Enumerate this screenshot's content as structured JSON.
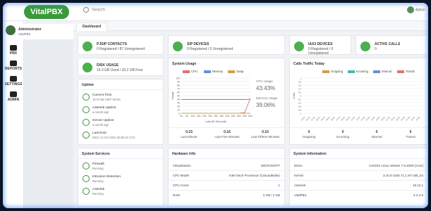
{
  "app": {
    "logo": "VitalPBX",
    "search_placeholder": "Search",
    "user_top": "Admin"
  },
  "user": {
    "name": "Administrator",
    "role": "VitalPBX"
  },
  "nav": [
    {
      "label": "PBX"
    },
    {
      "label": "REPORTS"
    },
    {
      "label": "SETTINGS"
    },
    {
      "label": "ADMIN"
    }
  ],
  "tab": {
    "label": "Dashboard"
  },
  "stats": [
    {
      "title": "PJSIP CONTACTS",
      "value": "0 Registered / 87 Unregistered"
    },
    {
      "title": "SIP DEVICES",
      "value": "0 Registered / 0 Unregistered"
    },
    {
      "title": "IAX2 DEVICES",
      "value": "0 Registered / 0 Unregistered"
    },
    {
      "title": "ACTIVE CALLS",
      "value": "0"
    }
  ],
  "disk": {
    "title": "DISK USAGE",
    "value": "16.3 GB Used / 33.2 GB Free"
  },
  "uptime": {
    "title": "Uptime",
    "rows": [
      {
        "title": "Current Time",
        "sub": "15:47:56 GMT+00:00"
      },
      {
        "title": "Asterisk Uptime",
        "sub": "a month ago"
      },
      {
        "title": "Server Uptime",
        "sub": "a month ago"
      },
      {
        "title": "Last boot",
        "sub": "Wed, 12 Oct 2022 20:55:31 UTC"
      }
    ]
  },
  "services": {
    "title": "System Services",
    "rows": [
      {
        "title": "Firewall",
        "sub": "Running"
      },
      {
        "title": "Intrusion Detection",
        "sub": "Running"
      },
      {
        "title": "Asterisk",
        "sub": "Running"
      }
    ]
  },
  "sys_usage": {
    "title": "System Usage",
    "legend": [
      "CPU",
      "Memory",
      "Swap"
    ],
    "cpu_label": "CPU Usage",
    "cpu_value": "43.43%",
    "mem_label": "Memory Usage",
    "mem_value": "39.06%",
    "ylabel": "Usage",
    "xlabel": "Last 60 Seconds",
    "footer": [
      {
        "value": "0.15",
        "label": "Last Minute"
      },
      {
        "value": "0.16",
        "label": "Last Five Minutes"
      },
      {
        "value": "0.15",
        "label": "Last Fifteen Minutes"
      }
    ]
  },
  "calls": {
    "title": "Calls Traffic Today",
    "legend": [
      "Outgoing",
      "Incoming",
      "Internal",
      "Transit"
    ],
    "ylabel": "Calls",
    "footer": [
      {
        "value": "0",
        "label": "Outgoing"
      },
      {
        "value": "0",
        "label": "Incoming"
      },
      {
        "value": "0",
        "label": "Internal"
      },
      {
        "value": "0",
        "label": "Transit"
      }
    ]
  },
  "hardware": {
    "title": "Hardware Info",
    "rows": [
      {
        "k": "Virtualization",
        "v": "MICROSOFT"
      },
      {
        "k": "CPU Model",
        "v": "Intel Xeon Processor (Cascadelake)"
      },
      {
        "k": "CPU Cores",
        "v": "1"
      },
      {
        "k": "RAM",
        "v": "2 GB / 2 GB"
      }
    ]
  },
  "sysinfo": {
    "title": "System Information",
    "rows": [
      {
        "k": "Distro",
        "v": "CentOS Linux release 7.9.2009 (Core)"
      },
      {
        "k": "Kernel",
        "v": "3.10.0-1160.71.1.el7.x86_64"
      },
      {
        "k": "Asterisk",
        "v": "18.12.1"
      },
      {
        "k": "VitalPBX",
        "v": "3.2.3-5"
      }
    ]
  },
  "colors": {
    "cpu": "#e0736b",
    "memory": "#6b8fd6",
    "swap": "#c9a24a",
    "outgoing": "#c9a24a",
    "incoming": "#4db6ac",
    "internal": "#6b8fd6",
    "transit": "#e0736b",
    "green": "#4caf50"
  },
  "chart_data": [
    {
      "type": "line",
      "x": [
        "0s",
        "5s",
        "10s",
        "15s",
        "20s",
        "25s",
        "30s",
        "35s",
        "40s",
        "45s",
        "50s",
        "55s",
        "60s"
      ],
      "series": [
        {
          "name": "CPU",
          "values": [
            0,
            0,
            0,
            0,
            0,
            0,
            0,
            0,
            0,
            0,
            0,
            2,
            43
          ]
        },
        {
          "name": "Memory",
          "values": [
            39,
            39,
            39,
            39,
            39,
            39,
            39,
            39,
            39,
            39,
            39,
            39,
            39
          ]
        },
        {
          "name": "Swap",
          "values": [
            0,
            0,
            0,
            0,
            0,
            0,
            0,
            0,
            0,
            0,
            0,
            0,
            0
          ]
        }
      ],
      "ylabel": "Usage",
      "xlabel": "Last 60 Seconds",
      "ylim": [
        0,
        100
      ]
    },
    {
      "type": "bar",
      "categories": [
        "00:00",
        "01:00",
        "02:00",
        "03:00",
        "04:00",
        "05:00",
        "06:00",
        "07:00",
        "08:00",
        "09:00",
        "10:00",
        "11:00",
        "12:00",
        "13:00",
        "14:00",
        "15:00",
        "16:00",
        "17:00",
        "18:00",
        "19:00",
        "20:00",
        "21:00",
        "22:00",
        "23:00"
      ],
      "series": [
        {
          "name": "Outgoing",
          "values": [
            0,
            0,
            0,
            0,
            0,
            0,
            0,
            0,
            0,
            0,
            0,
            0,
            0,
            0,
            0,
            0,
            0,
            0,
            0,
            0,
            0,
            0,
            0,
            0
          ]
        },
        {
          "name": "Incoming",
          "values": [
            0,
            0,
            0,
            0,
            0,
            0,
            0,
            0,
            0,
            0,
            0,
            0,
            0,
            0,
            0,
            0,
            0,
            0,
            0,
            0,
            0,
            0,
            0,
            0
          ]
        },
        {
          "name": "Internal",
          "values": [
            0,
            0,
            0,
            0,
            0,
            0,
            0,
            0,
            0,
            0,
            0,
            0,
            0,
            0,
            0,
            0,
            0,
            0,
            0,
            0,
            0,
            0,
            0,
            0
          ]
        },
        {
          "name": "Transit",
          "values": [
            0,
            0,
            0,
            0,
            0,
            0,
            0,
            0,
            0,
            0,
            0,
            0,
            0,
            0,
            0,
            0,
            0,
            0,
            0,
            0,
            0,
            0,
            0,
            0
          ]
        }
      ],
      "ylabel": "Calls"
    }
  ]
}
